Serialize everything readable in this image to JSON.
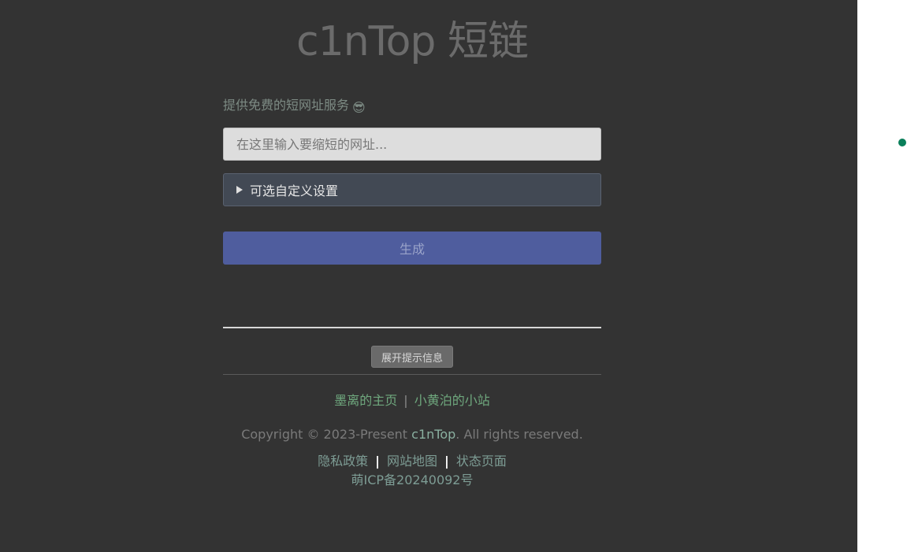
{
  "header": {
    "title": "c1nTop 短链"
  },
  "form": {
    "tagline": "提供免费的短网址服务",
    "tagline_emoji": "😎",
    "url_placeholder": "在这里输入要缩短的网址...",
    "url_value": "",
    "options_label": "可选自定义设置",
    "generate_label": "生成"
  },
  "tips": {
    "toggle_label": "展开提示信息"
  },
  "footer": {
    "links_top": [
      {
        "label": "墨离的主页"
      },
      {
        "label": "小黄泊的小站"
      }
    ],
    "top_separator": "|",
    "copyright_prefix": "Copyright © 2023-Present ",
    "copyright_brand": "c1nTop",
    "copyright_suffix": ". All rights reserved.",
    "links_bottom": [
      {
        "label": "隐私政策"
      },
      {
        "label": "网站地图"
      },
      {
        "label": "状态页面"
      }
    ],
    "bottom_separator": "|",
    "icp": "萌ICP备20240092号"
  },
  "colors": {
    "panel_background": "#333333",
    "accent_button": "#4f5d9e",
    "link_green": "#6fa87e",
    "status_dot": "#0a7f5a"
  }
}
